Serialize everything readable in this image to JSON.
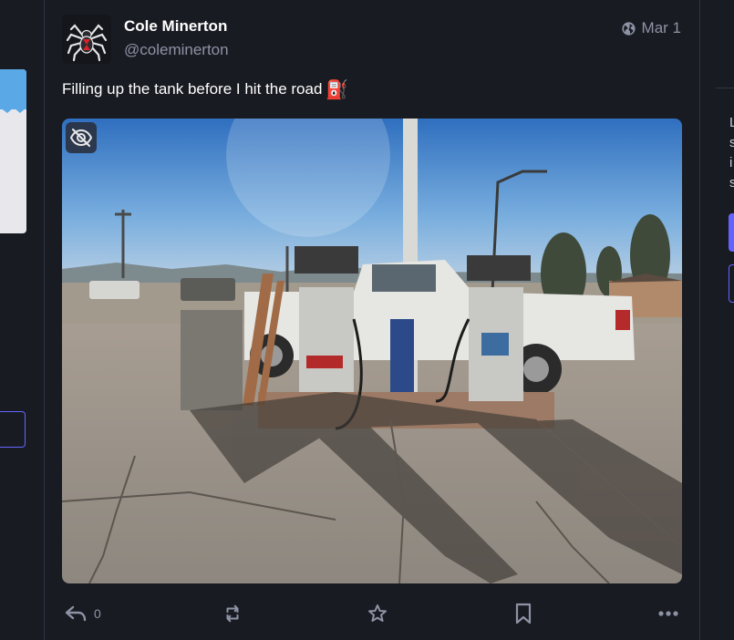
{
  "status": {
    "display_name": "Cole Minerton",
    "handle": "@coleminerton",
    "date": "Mar 1",
    "visibility_icon": "globe-icon",
    "text": "Filling up the tank before I hit the road",
    "emoji": "⛽",
    "media": {
      "alt": "Photo of gas pumps with a white pickup truck behind them",
      "hide_icon": "eye-slash-icon"
    },
    "actions": {
      "reply_count": "0",
      "reply_icon": "reply-icon",
      "boost_icon": "retweet-icon",
      "favourite_icon": "star-icon",
      "bookmark_icon": "bookmark-icon",
      "more_icon": "ellipsis-icon"
    }
  },
  "right_sidebar": {
    "lines": [
      "L",
      "s",
      "i",
      "s"
    ]
  },
  "colors": {
    "background": "#191b22",
    "accent": "#6364ff",
    "muted": "#8d93a5",
    "divider": "#313543"
  }
}
